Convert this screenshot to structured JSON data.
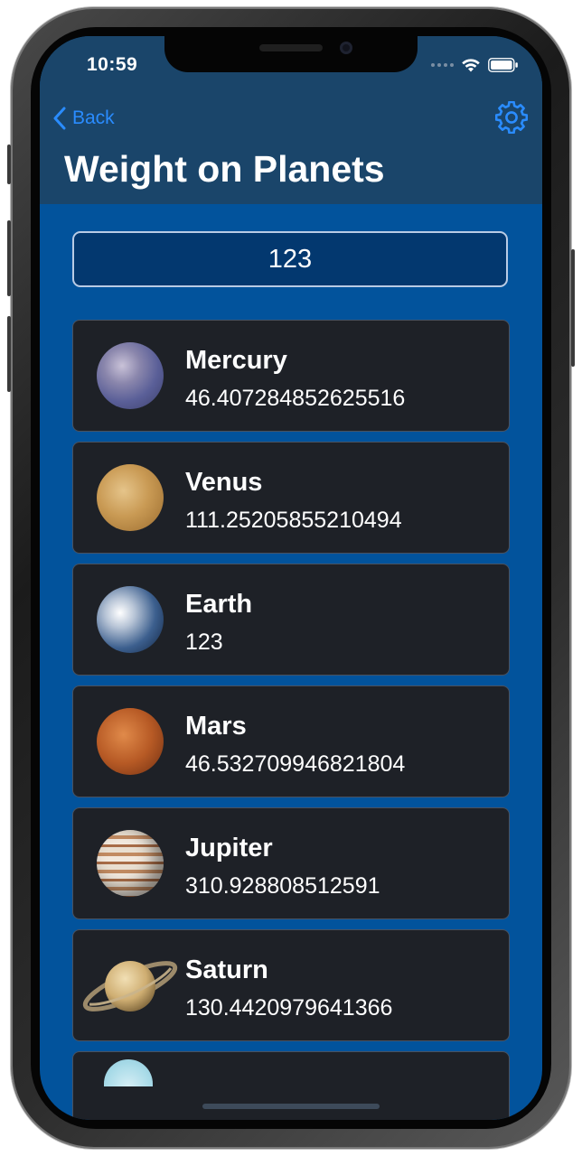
{
  "status_bar": {
    "time": "10:59"
  },
  "nav": {
    "back_label": "Back",
    "title": "Weight on Planets"
  },
  "weight_input": {
    "value": "123"
  },
  "planets": [
    {
      "name": "Mercury",
      "weight": "46.407284852625516"
    },
    {
      "name": "Venus",
      "weight": "111.25205855210494"
    },
    {
      "name": "Earth",
      "weight": "123"
    },
    {
      "name": "Mars",
      "weight": "46.532709946821804"
    },
    {
      "name": "Jupiter",
      "weight": "310.928808512591"
    },
    {
      "name": "Saturn",
      "weight": "130.4420979641366"
    }
  ],
  "colors": {
    "nav_background": "#1a456a",
    "content_background": "#02539c",
    "card_background": "#1e2127",
    "accent": "#2a8cff"
  },
  "icons": [
    "back-chevron-icon",
    "gear-icon",
    "wifi-icon",
    "battery-icon",
    "signal-dots-icon"
  ]
}
